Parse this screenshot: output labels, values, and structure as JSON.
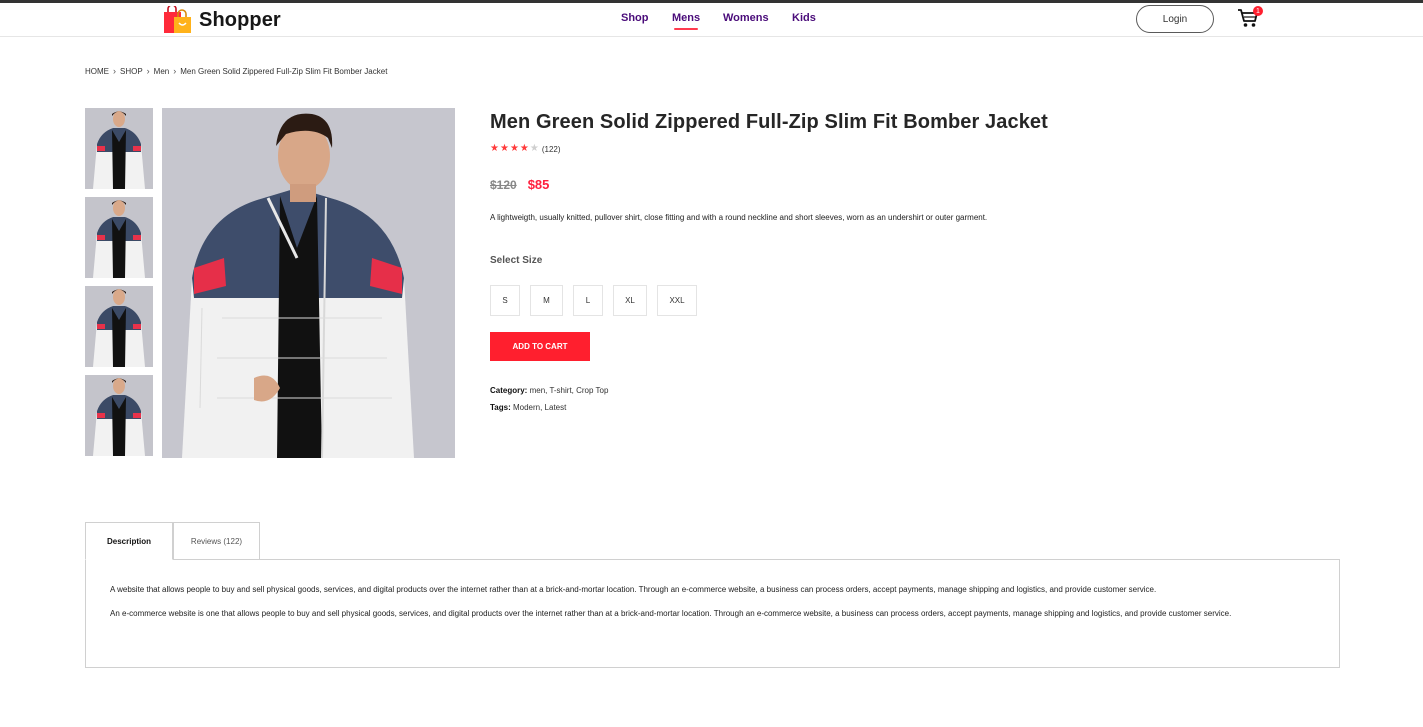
{
  "brand": {
    "name": "Shopper",
    "logo_icon": "shopping-bags-icon"
  },
  "nav": {
    "links": [
      {
        "label": "Shop"
      },
      {
        "label": "Mens"
      },
      {
        "label": "Womens"
      },
      {
        "label": "Kids"
      }
    ],
    "active": "Mens",
    "login_label": "Login",
    "cart_icon": "cart-icon",
    "cart_count": "1"
  },
  "breadcrumb": [
    "HOME",
    "SHOP",
    "Men",
    "Men Green Solid Zippered Full-Zip Slim Fit Bomber Jacket"
  ],
  "product": {
    "title": "Men Green Solid Zippered Full-Zip Slim Fit Bomber Jacket",
    "rating": 4,
    "rating_max": 5,
    "rating_count": "(122)",
    "old_price": "$120",
    "new_price": "$85",
    "description": "A lightweigth, usually knitted, pullover shirt, close fitting and with a round neckline and short sleeves, worn as an undershirt or outer garment.",
    "size_label": "Select Size",
    "sizes": [
      "S",
      "M",
      "L",
      "XL",
      "XXL"
    ],
    "add_to_cart_label": "ADD TO CART",
    "category_label": "Category:",
    "category_value": "men, T-shirt, Crop Top",
    "tags_label": "Tags:",
    "tags_value": "Modern, Latest"
  },
  "tabs": {
    "items": [
      {
        "label": "Description"
      },
      {
        "label": "Reviews (122)"
      }
    ],
    "active": "Description",
    "description_paragraphs": [
      "A website that allows people to buy and sell physical goods, services, and digital products over the internet rather than at a brick-and-mortar location. Through an e-commerce website, a business can process orders, accept payments, manage shipping and logistics, and provide customer service.",
      "An e-commerce website is one that allows people to buy and sell physical goods, services, and digital products over the internet rather than at a brick-and-mortar location. Through an e-commerce website, a business can process orders, accept payments, manage shipping and logistics, and provide customer service."
    ]
  },
  "colors": {
    "accent": "#ff1f2e",
    "nav_text": "#4a0c7a",
    "star_on": "#ff3b3b"
  }
}
